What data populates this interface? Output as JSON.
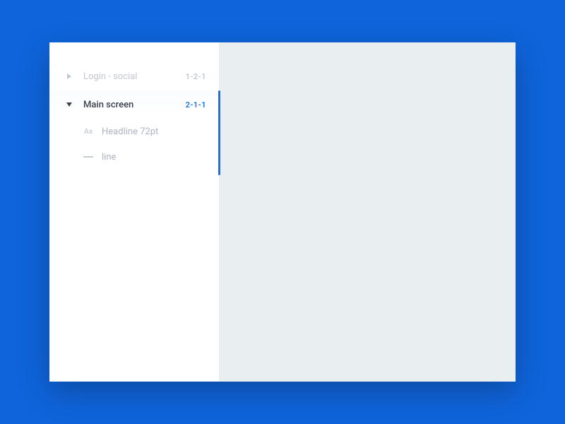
{
  "colors": {
    "background": "#0f64db",
    "canvas": "#e9eef0",
    "accent": "#1473e6",
    "text_primary": "#3b4350",
    "text_muted": "#c2c8d0"
  },
  "sidebar": {
    "items": [
      {
        "label": "Login - social",
        "code": "1-2-1",
        "expanded": false,
        "active": false
      },
      {
        "label": "Main screen",
        "code": "2-1-1",
        "expanded": true,
        "active": true,
        "children": [
          {
            "icon": "text-style",
            "icon_label": "Aa",
            "label": "Headline 72pt"
          },
          {
            "icon": "line",
            "label": "line"
          }
        ]
      }
    ]
  }
}
